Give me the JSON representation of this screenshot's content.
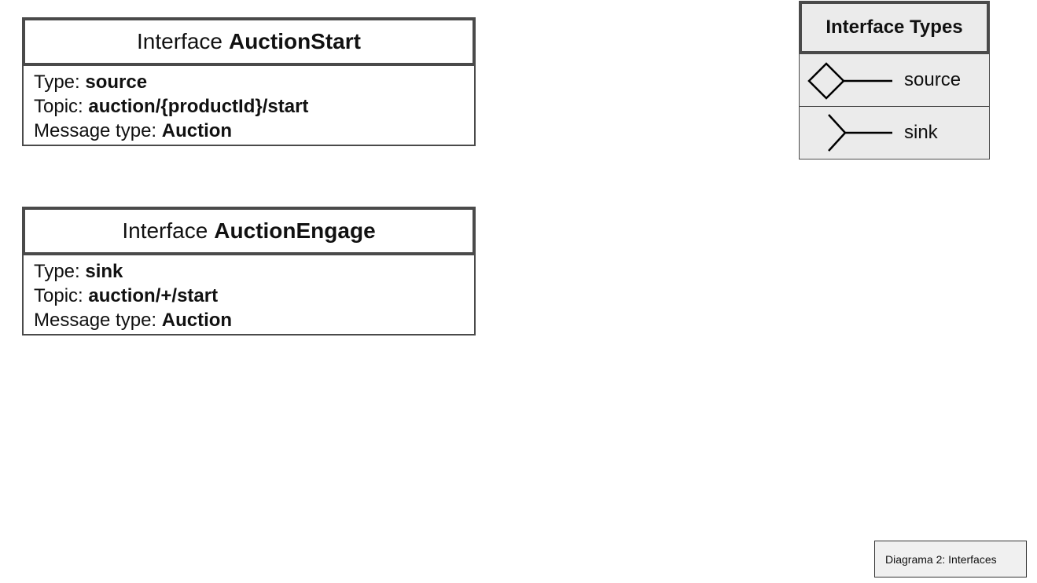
{
  "interfaces": [
    {
      "prefix": "Interface",
      "name": "AuctionStart",
      "type_label": "Type:",
      "type_value": "source",
      "topic_label": "Topic:",
      "topic_value": "auction/{productId}/start",
      "message_label": "Message type:",
      "message_value": "Auction"
    },
    {
      "prefix": "Interface",
      "name": "AuctionEngage",
      "type_label": "Type:",
      "type_value": "sink",
      "topic_label": "Topic:",
      "topic_value": "auction/+/start",
      "message_label": "Message type:",
      "message_value": "Auction"
    }
  ],
  "legend": {
    "title": "Interface Types",
    "items": [
      {
        "label": "source",
        "icon": "diamond-connector-icon"
      },
      {
        "label": "sink",
        "icon": "fork-connector-icon"
      }
    ]
  },
  "caption": "Diagrama 2: Interfaces",
  "colors": {
    "border": "#4a4a4a",
    "legend_fill": "#ebebeb",
    "caption_fill": "#f0f0f0"
  }
}
